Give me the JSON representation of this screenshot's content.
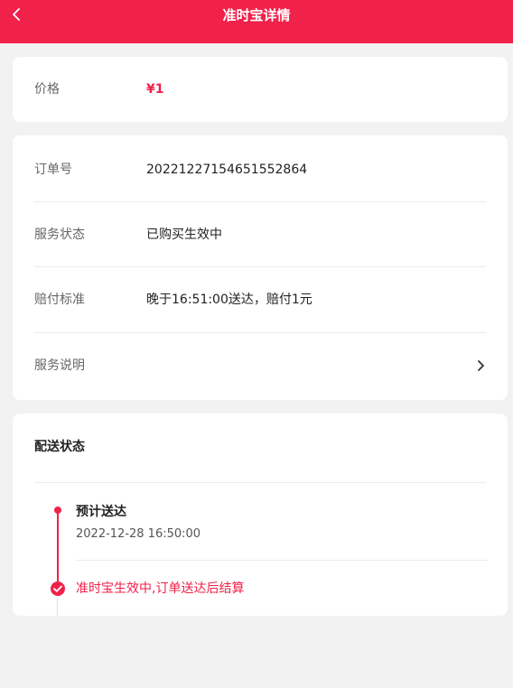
{
  "header": {
    "title": "准时宝详情",
    "back_icon": "chevron-left-icon"
  },
  "price_card": {
    "label": "价格",
    "value": "¥1"
  },
  "info_card": {
    "order_label": "订单号",
    "order_value": "20221227154651552864",
    "status_label": "服务状态",
    "status_value": "已购买生效中",
    "compensation_label": "赔付标准",
    "compensation_value": "晚于16:51:00送达，赔付1元",
    "description_label": "服务说明",
    "description_icon": "chevron-right-icon"
  },
  "delivery_card": {
    "title": "配送状态",
    "steps": [
      {
        "title": "预计送达",
        "time": "2022-12-28 16:50:00"
      },
      {
        "text": "准时宝生效中,订单送达后结算"
      }
    ]
  },
  "colors": {
    "accent": "#f0224a",
    "background": "#f2f2f2",
    "card": "#ffffff"
  }
}
